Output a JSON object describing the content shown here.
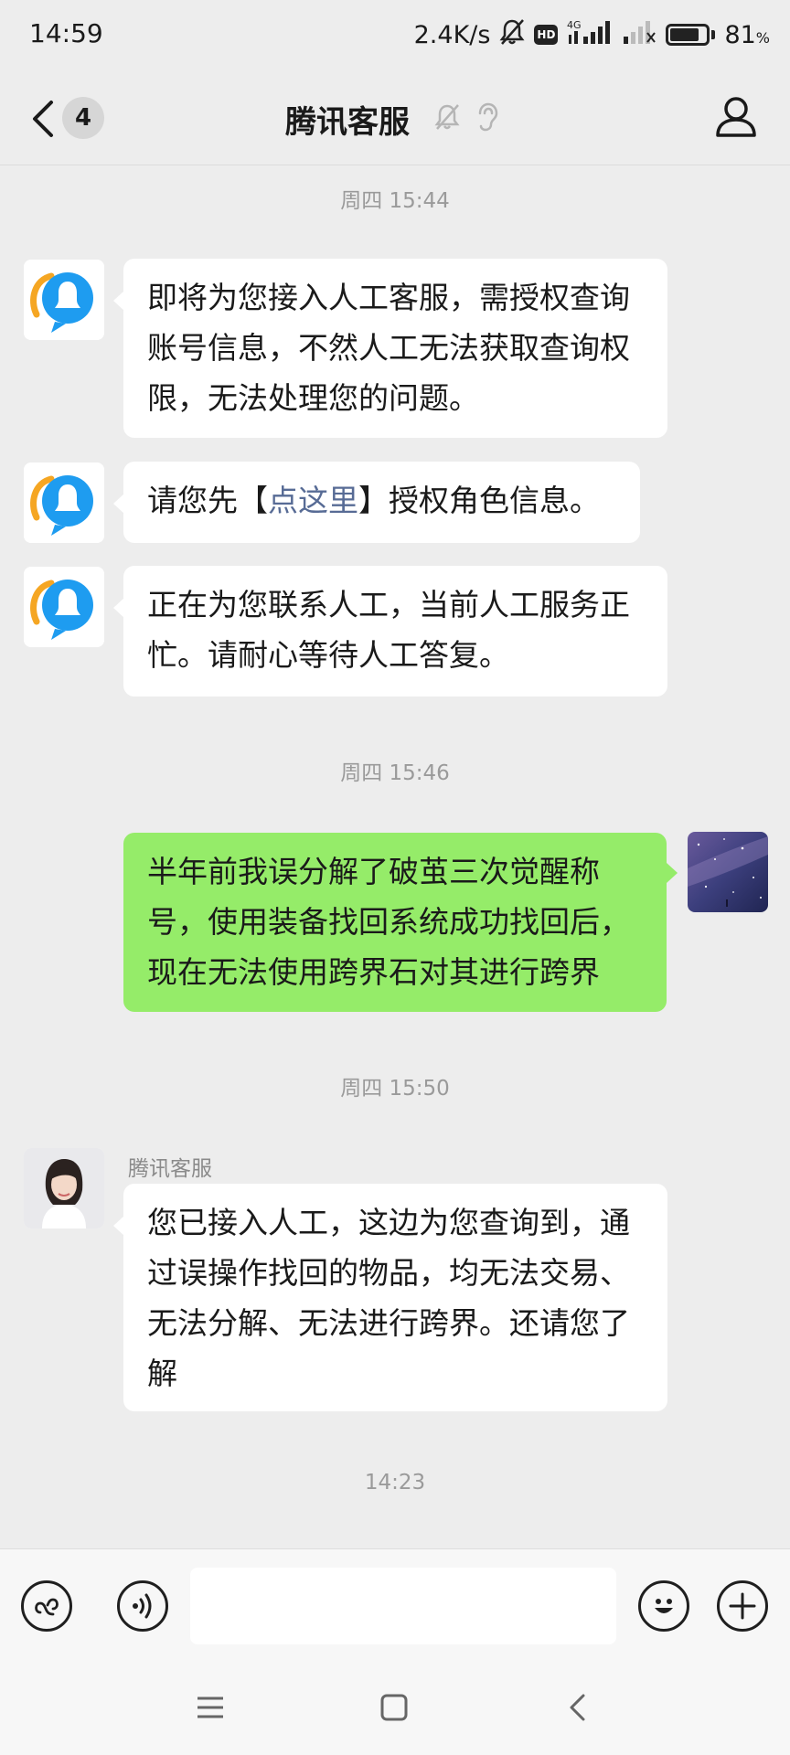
{
  "status_bar": {
    "time": "14:59",
    "network_speed": "2.4K/s",
    "network_type": "4G",
    "battery_percent": 81,
    "battery_label": "81",
    "battery_unit": "%",
    "icons": [
      "bell-muted-icon",
      "hd-icon",
      "signal-icon",
      "signal-weak-icon",
      "battery-icon"
    ]
  },
  "header": {
    "unread_count": "4",
    "title": "腾讯客服",
    "icons": [
      "back-icon",
      "bell-muted-icon",
      "ear-icon",
      "profile-icon"
    ]
  },
  "messages": {
    "ts1": "周四 15:44",
    "m1": "即将为您接入人工客服，需授权查询账号信息，不然人工无法获取查询权限，无法处理您的问题。",
    "m2_pre": "请您先【",
    "m2_link": "点这里",
    "m2_post": "】授权角色信息。",
    "m3": "正在为您联系人工，当前人工服务正忙。请耐心等待人工答复。",
    "ts2": "周四 15:46",
    "m4": "半年前我误分解了破茧三次觉醒称号，使用装备找回系统成功找回后，现在无法使用跨界石对其进行跨界",
    "ts3": "周四 15:50",
    "sender_name": "腾讯客服",
    "m5": "您已接入人工，这边为您查询到，通过误操作找回的物品，均无法交易、无法分解、无法进行跨界。还请您了解",
    "ts4": "14:23"
  },
  "input_bar": {
    "value": "",
    "icons": [
      "mini-program-icon",
      "voice-icon",
      "emoji-icon",
      "plus-icon"
    ]
  },
  "nav_bar": {
    "icons": [
      "menu-icon",
      "home-icon",
      "back-nav-icon"
    ]
  },
  "colors": {
    "background": "#ededed",
    "sent_bubble": "#95ec69",
    "received_bubble": "#ffffff",
    "link": "#576b95",
    "bot_avatar_blue": "#1e9cf0",
    "bot_avatar_orange": "#f5a623"
  }
}
